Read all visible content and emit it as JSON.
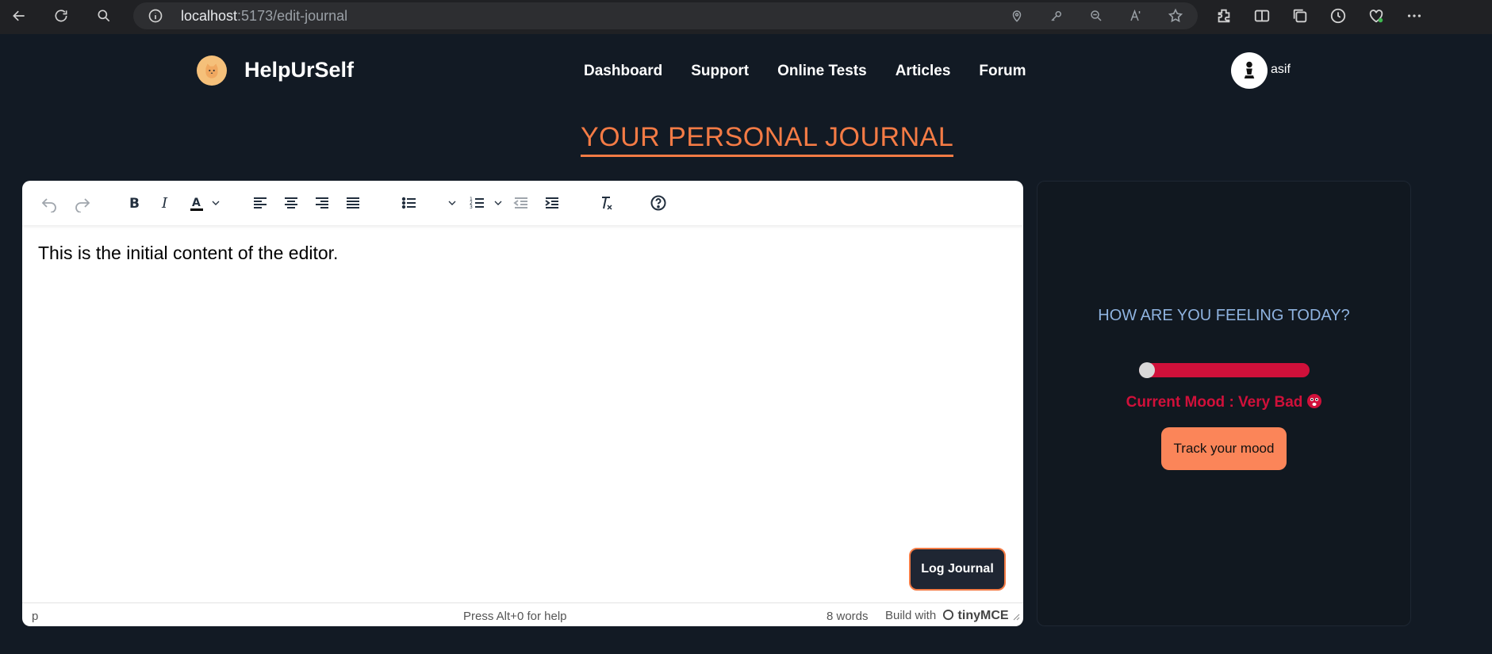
{
  "browser": {
    "url_host": "localhost",
    "url_path": ":5173/edit-journal"
  },
  "navbar": {
    "brand": "HelpUrSelf",
    "links": [
      "Dashboard",
      "Support",
      "Online Tests",
      "Articles",
      "Forum"
    ],
    "username": "asif"
  },
  "page": {
    "title": "YOUR PERSONAL JOURNAL"
  },
  "editor": {
    "content": "This is the initial content of the editor.",
    "status_path": "p",
    "status_help": "Press Alt+0 for help",
    "word_count": "8 words",
    "build_with": "Build with",
    "brand": "tinyMCE",
    "log_button": "Log Journal"
  },
  "mood": {
    "question": "HOW ARE YOU FEELING TODAY?",
    "current": "Current Mood : Very Bad",
    "level": 0,
    "track_button": "Track your mood",
    "color": "#d0103a"
  },
  "colors": {
    "accent": "#f47b45",
    "background": "#121a24",
    "mood_bad": "#d0103a",
    "button_orange": "#fb8559"
  }
}
